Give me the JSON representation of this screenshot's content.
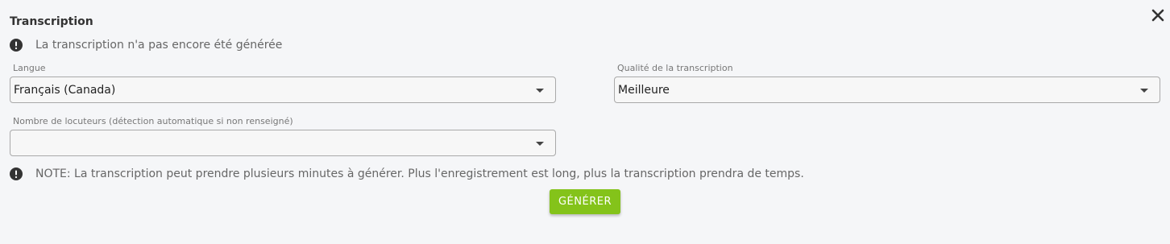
{
  "panel": {
    "title": "Transcription",
    "close_icon": "close-icon"
  },
  "status": {
    "message": "La transcription n'a pas encore été générée",
    "icon": "exclamation-circle-icon"
  },
  "language": {
    "label": "Langue",
    "value": "Français (Canada)"
  },
  "quality": {
    "label": "Qualité de la transcription",
    "value": "Meilleure"
  },
  "speakers": {
    "label": "Nombre de locuteurs (détection automatique si non renseigné)",
    "value": ""
  },
  "note": {
    "message": "NOTE: La transcription peut prendre plusieurs minutes à générer. Plus l'enregistrement est long, plus la transcription prendra de temps.",
    "icon": "exclamation-circle-icon"
  },
  "actions": {
    "generate_label": "GÉNÉRER",
    "generate_color": "#84c31a"
  }
}
